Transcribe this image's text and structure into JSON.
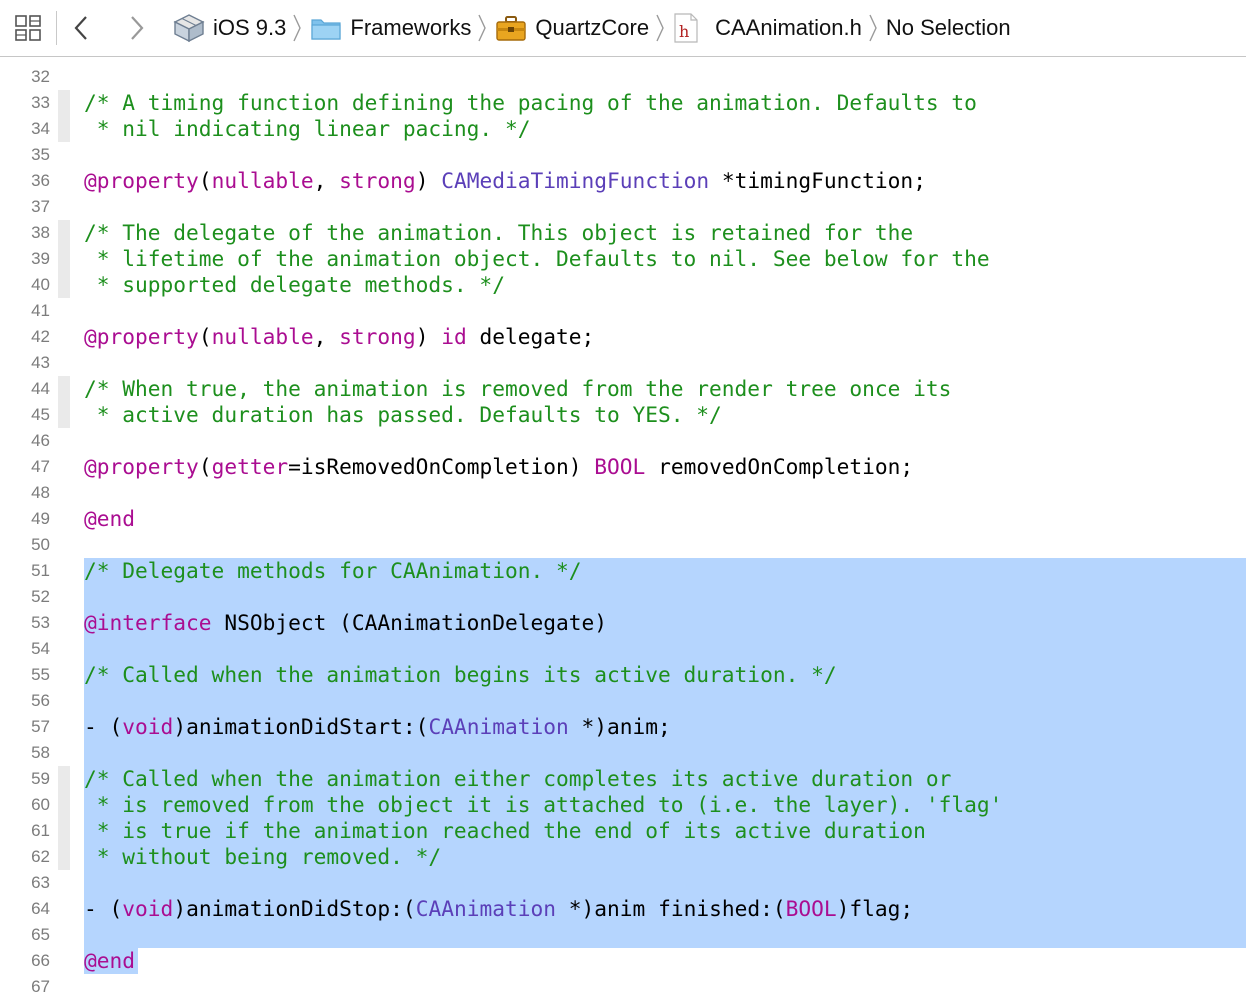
{
  "jumpbar": {
    "crumbs": [
      {
        "label": "iOS 9.3",
        "icon": "sdk-icon"
      },
      {
        "label": "Frameworks",
        "icon": "folder-icon"
      },
      {
        "label": "QuartzCore",
        "icon": "framework-toolbox-icon"
      },
      {
        "label": "CAAnimation.h",
        "icon": "header-file-icon"
      },
      {
        "label": "No Selection",
        "icon": ""
      }
    ]
  },
  "colors": {
    "comment": "#1d8f1d",
    "keyword": "#aa0d91",
    "type": "#5b3fb8",
    "selection": "#b5d5fe"
  },
  "editor": {
    "lines": [
      {
        "n": "32",
        "fold": false,
        "sel": "none",
        "tokens": []
      },
      {
        "n": "33",
        "fold": true,
        "sel": "none",
        "tokens": [
          {
            "c": "comment",
            "t": "/* A timing function defining the pacing of the animation. Defaults to"
          }
        ]
      },
      {
        "n": "34",
        "fold": true,
        "sel": "none",
        "tokens": [
          {
            "c": "comment",
            "t": " * nil indicating linear pacing. */"
          }
        ]
      },
      {
        "n": "35",
        "fold": false,
        "sel": "none",
        "tokens": []
      },
      {
        "n": "36",
        "fold": false,
        "sel": "none",
        "tokens": [
          {
            "c": "kw",
            "t": "@property"
          },
          {
            "c": "plain",
            "t": "("
          },
          {
            "c": "kw",
            "t": "nullable"
          },
          {
            "c": "plain",
            "t": ", "
          },
          {
            "c": "kw",
            "t": "strong"
          },
          {
            "c": "plain",
            "t": ") "
          },
          {
            "c": "type",
            "t": "CAMediaTimingFunction"
          },
          {
            "c": "plain",
            "t": " *timingFunction;"
          }
        ]
      },
      {
        "n": "37",
        "fold": false,
        "sel": "none",
        "tokens": []
      },
      {
        "n": "38",
        "fold": true,
        "sel": "none",
        "tokens": [
          {
            "c": "comment",
            "t": "/* The delegate of the animation. This object is retained for the"
          }
        ]
      },
      {
        "n": "39",
        "fold": true,
        "sel": "none",
        "tokens": [
          {
            "c": "comment",
            "t": " * lifetime of the animation object. Defaults to nil. See below for the"
          }
        ]
      },
      {
        "n": "40",
        "fold": true,
        "sel": "none",
        "tokens": [
          {
            "c": "comment",
            "t": " * supported delegate methods. */"
          }
        ]
      },
      {
        "n": "41",
        "fold": false,
        "sel": "none",
        "tokens": []
      },
      {
        "n": "42",
        "fold": false,
        "sel": "none",
        "tokens": [
          {
            "c": "kw",
            "t": "@property"
          },
          {
            "c": "plain",
            "t": "("
          },
          {
            "c": "kw",
            "t": "nullable"
          },
          {
            "c": "plain",
            "t": ", "
          },
          {
            "c": "kw",
            "t": "strong"
          },
          {
            "c": "plain",
            "t": ") "
          },
          {
            "c": "kw",
            "t": "id"
          },
          {
            "c": "plain",
            "t": " delegate;"
          }
        ]
      },
      {
        "n": "43",
        "fold": false,
        "sel": "none",
        "tokens": []
      },
      {
        "n": "44",
        "fold": true,
        "sel": "none",
        "tokens": [
          {
            "c": "comment",
            "t": "/* When true, the animation is removed from the render tree once its"
          }
        ]
      },
      {
        "n": "45",
        "fold": true,
        "sel": "none",
        "tokens": [
          {
            "c": "comment",
            "t": " * active duration has passed. Defaults to YES. */"
          }
        ]
      },
      {
        "n": "46",
        "fold": false,
        "sel": "none",
        "tokens": []
      },
      {
        "n": "47",
        "fold": false,
        "sel": "none",
        "tokens": [
          {
            "c": "kw",
            "t": "@property"
          },
          {
            "c": "plain",
            "t": "("
          },
          {
            "c": "kw",
            "t": "getter"
          },
          {
            "c": "plain",
            "t": "=isRemovedOnCompletion) "
          },
          {
            "c": "kw",
            "t": "BOOL"
          },
          {
            "c": "plain",
            "t": " removedOnCompletion;"
          }
        ]
      },
      {
        "n": "48",
        "fold": false,
        "sel": "none",
        "tokens": []
      },
      {
        "n": "49",
        "fold": false,
        "sel": "none",
        "tokens": [
          {
            "c": "kw",
            "t": "@end"
          }
        ]
      },
      {
        "n": "50",
        "fold": false,
        "sel": "none",
        "tokens": []
      },
      {
        "n": "51",
        "fold": false,
        "sel": "full",
        "tokens": [
          {
            "c": "comment",
            "t": "/* Delegate methods for CAAnimation. */"
          }
        ]
      },
      {
        "n": "52",
        "fold": false,
        "sel": "full",
        "tokens": []
      },
      {
        "n": "53",
        "fold": false,
        "sel": "full",
        "tokens": [
          {
            "c": "kw",
            "t": "@interface"
          },
          {
            "c": "plain",
            "t": " NSObject (CAAnimationDelegate)"
          }
        ]
      },
      {
        "n": "54",
        "fold": false,
        "sel": "full",
        "tokens": []
      },
      {
        "n": "55",
        "fold": false,
        "sel": "full",
        "tokens": [
          {
            "c": "comment",
            "t": "/* Called when the animation begins its active duration. */"
          }
        ]
      },
      {
        "n": "56",
        "fold": false,
        "sel": "full",
        "tokens": []
      },
      {
        "n": "57",
        "fold": false,
        "sel": "full",
        "tokens": [
          {
            "c": "plain",
            "t": "- ("
          },
          {
            "c": "kw",
            "t": "void"
          },
          {
            "c": "plain",
            "t": ")animationDidStart:("
          },
          {
            "c": "type",
            "t": "CAAnimation"
          },
          {
            "c": "plain",
            "t": " *)anim;"
          }
        ]
      },
      {
        "n": "58",
        "fold": false,
        "sel": "full",
        "tokens": []
      },
      {
        "n": "59",
        "fold": true,
        "sel": "full",
        "tokens": [
          {
            "c": "comment",
            "t": "/* Called when the animation either completes its active duration or"
          }
        ]
      },
      {
        "n": "60",
        "fold": true,
        "sel": "full",
        "tokens": [
          {
            "c": "comment",
            "t": " * is removed from the object it is attached to (i.e. the layer). 'flag'"
          }
        ]
      },
      {
        "n": "61",
        "fold": true,
        "sel": "full",
        "tokens": [
          {
            "c": "comment",
            "t": " * is true if the animation reached the end of its active duration"
          }
        ]
      },
      {
        "n": "62",
        "fold": true,
        "sel": "full",
        "tokens": [
          {
            "c": "comment",
            "t": " * without being removed. */"
          }
        ]
      },
      {
        "n": "63",
        "fold": false,
        "sel": "full",
        "tokens": []
      },
      {
        "n": "64",
        "fold": false,
        "sel": "full",
        "tokens": [
          {
            "c": "plain",
            "t": "- ("
          },
          {
            "c": "kw",
            "t": "void"
          },
          {
            "c": "plain",
            "t": ")animationDidStop:("
          },
          {
            "c": "type",
            "t": "CAAnimation"
          },
          {
            "c": "plain",
            "t": " *)anim finished:("
          },
          {
            "c": "kw",
            "t": "BOOL"
          },
          {
            "c": "plain",
            "t": ")flag;"
          }
        ]
      },
      {
        "n": "65",
        "fold": false,
        "sel": "full",
        "tokens": []
      },
      {
        "n": "66",
        "fold": false,
        "sel": "short",
        "tokens": [
          {
            "c": "kw",
            "t": "@end"
          }
        ]
      },
      {
        "n": "67",
        "fold": false,
        "sel": "none",
        "tokens": []
      }
    ]
  }
}
